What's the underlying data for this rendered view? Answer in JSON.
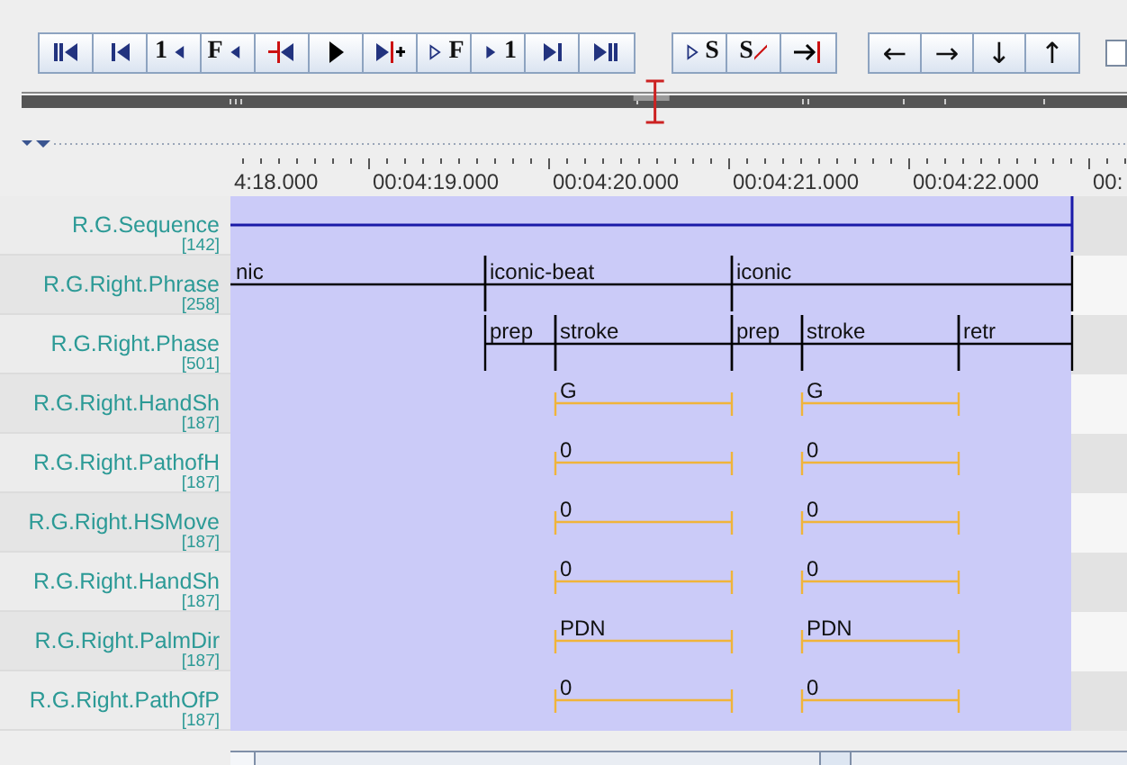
{
  "toolbar": {
    "groups": [
      {
        "buttons": [
          {
            "kind": "first"
          },
          {
            "kind": "prev"
          },
          {
            "kind": "prev-label",
            "label": "1"
          },
          {
            "kind": "prev-label",
            "label": "F"
          },
          {
            "kind": "prev-pixel"
          },
          {
            "kind": "play"
          },
          {
            "kind": "next-pixel"
          },
          {
            "kind": "next-outline-label",
            "label": "F"
          },
          {
            "kind": "next-label",
            "label": "1"
          },
          {
            "kind": "next"
          },
          {
            "kind": "last"
          }
        ]
      },
      {
        "buttons": [
          {
            "kind": "next-outline-label",
            "label": "S"
          },
          {
            "kind": "clear-label",
            "label": "S"
          },
          {
            "kind": "jump-end"
          }
        ]
      },
      {
        "buttons": [
          {
            "kind": "text",
            "label": "←"
          },
          {
            "kind": "text",
            "label": "→"
          },
          {
            "kind": "text",
            "label": "↓"
          },
          {
            "kind": "text",
            "label": "↑"
          }
        ]
      }
    ],
    "checkbox": {
      "checked": false
    }
  },
  "position_slider": {
    "level": 0.573
  },
  "ruler": {
    "labels": [
      "4:18.000",
      "00:04:19.000",
      "00:04:20.000",
      "00:04:21.000",
      "00:04:22.000",
      "00:"
    ]
  },
  "tiers": [
    {
      "name": "R.G.Sequence",
      "count": "[142]",
      "kind": "line"
    },
    {
      "name": "R.G.Right.Phrase",
      "count": "[258]",
      "kind": "phrase",
      "annotations": [
        {
          "value": "nic"
        },
        {
          "value": "iconic-beat"
        },
        {
          "value": "iconic"
        }
      ]
    },
    {
      "name": "R.G.Right.Phase",
      "count": "[501]",
      "kind": "phrase",
      "annotations": [
        {
          "value": "prep"
        },
        {
          "value": "stroke"
        },
        {
          "value": "prep"
        },
        {
          "value": "stroke"
        },
        {
          "value": "retr"
        }
      ]
    },
    {
      "name": "R.G.Right.HandSh",
      "count": "[187]",
      "kind": "symbol",
      "annotations": [
        {
          "value": "G"
        },
        {
          "value": "G"
        }
      ]
    },
    {
      "name": "R.G.Right.PathofH",
      "count": "[187]",
      "kind": "symbol",
      "annotations": [
        {
          "value": "0"
        },
        {
          "value": "0"
        }
      ]
    },
    {
      "name": "R.G.Right.HSMove",
      "count": "[187]",
      "kind": "symbol",
      "annotations": [
        {
          "value": "0"
        },
        {
          "value": "0"
        }
      ]
    },
    {
      "name": "R.G.Right.HandSh",
      "count": "[187]",
      "kind": "symbol",
      "annotations": [
        {
          "value": "0"
        },
        {
          "value": "0"
        }
      ]
    },
    {
      "name": "R.G.Right.PalmDir",
      "count": "[187]",
      "kind": "symbol",
      "annotations": [
        {
          "value": "PDN"
        },
        {
          "value": "PDN"
        }
      ]
    },
    {
      "name": "R.G.Right.PathOfP",
      "count": "[187]",
      "kind": "symbol",
      "annotations": [
        {
          "value": "0"
        },
        {
          "value": "0"
        }
      ]
    }
  ]
}
